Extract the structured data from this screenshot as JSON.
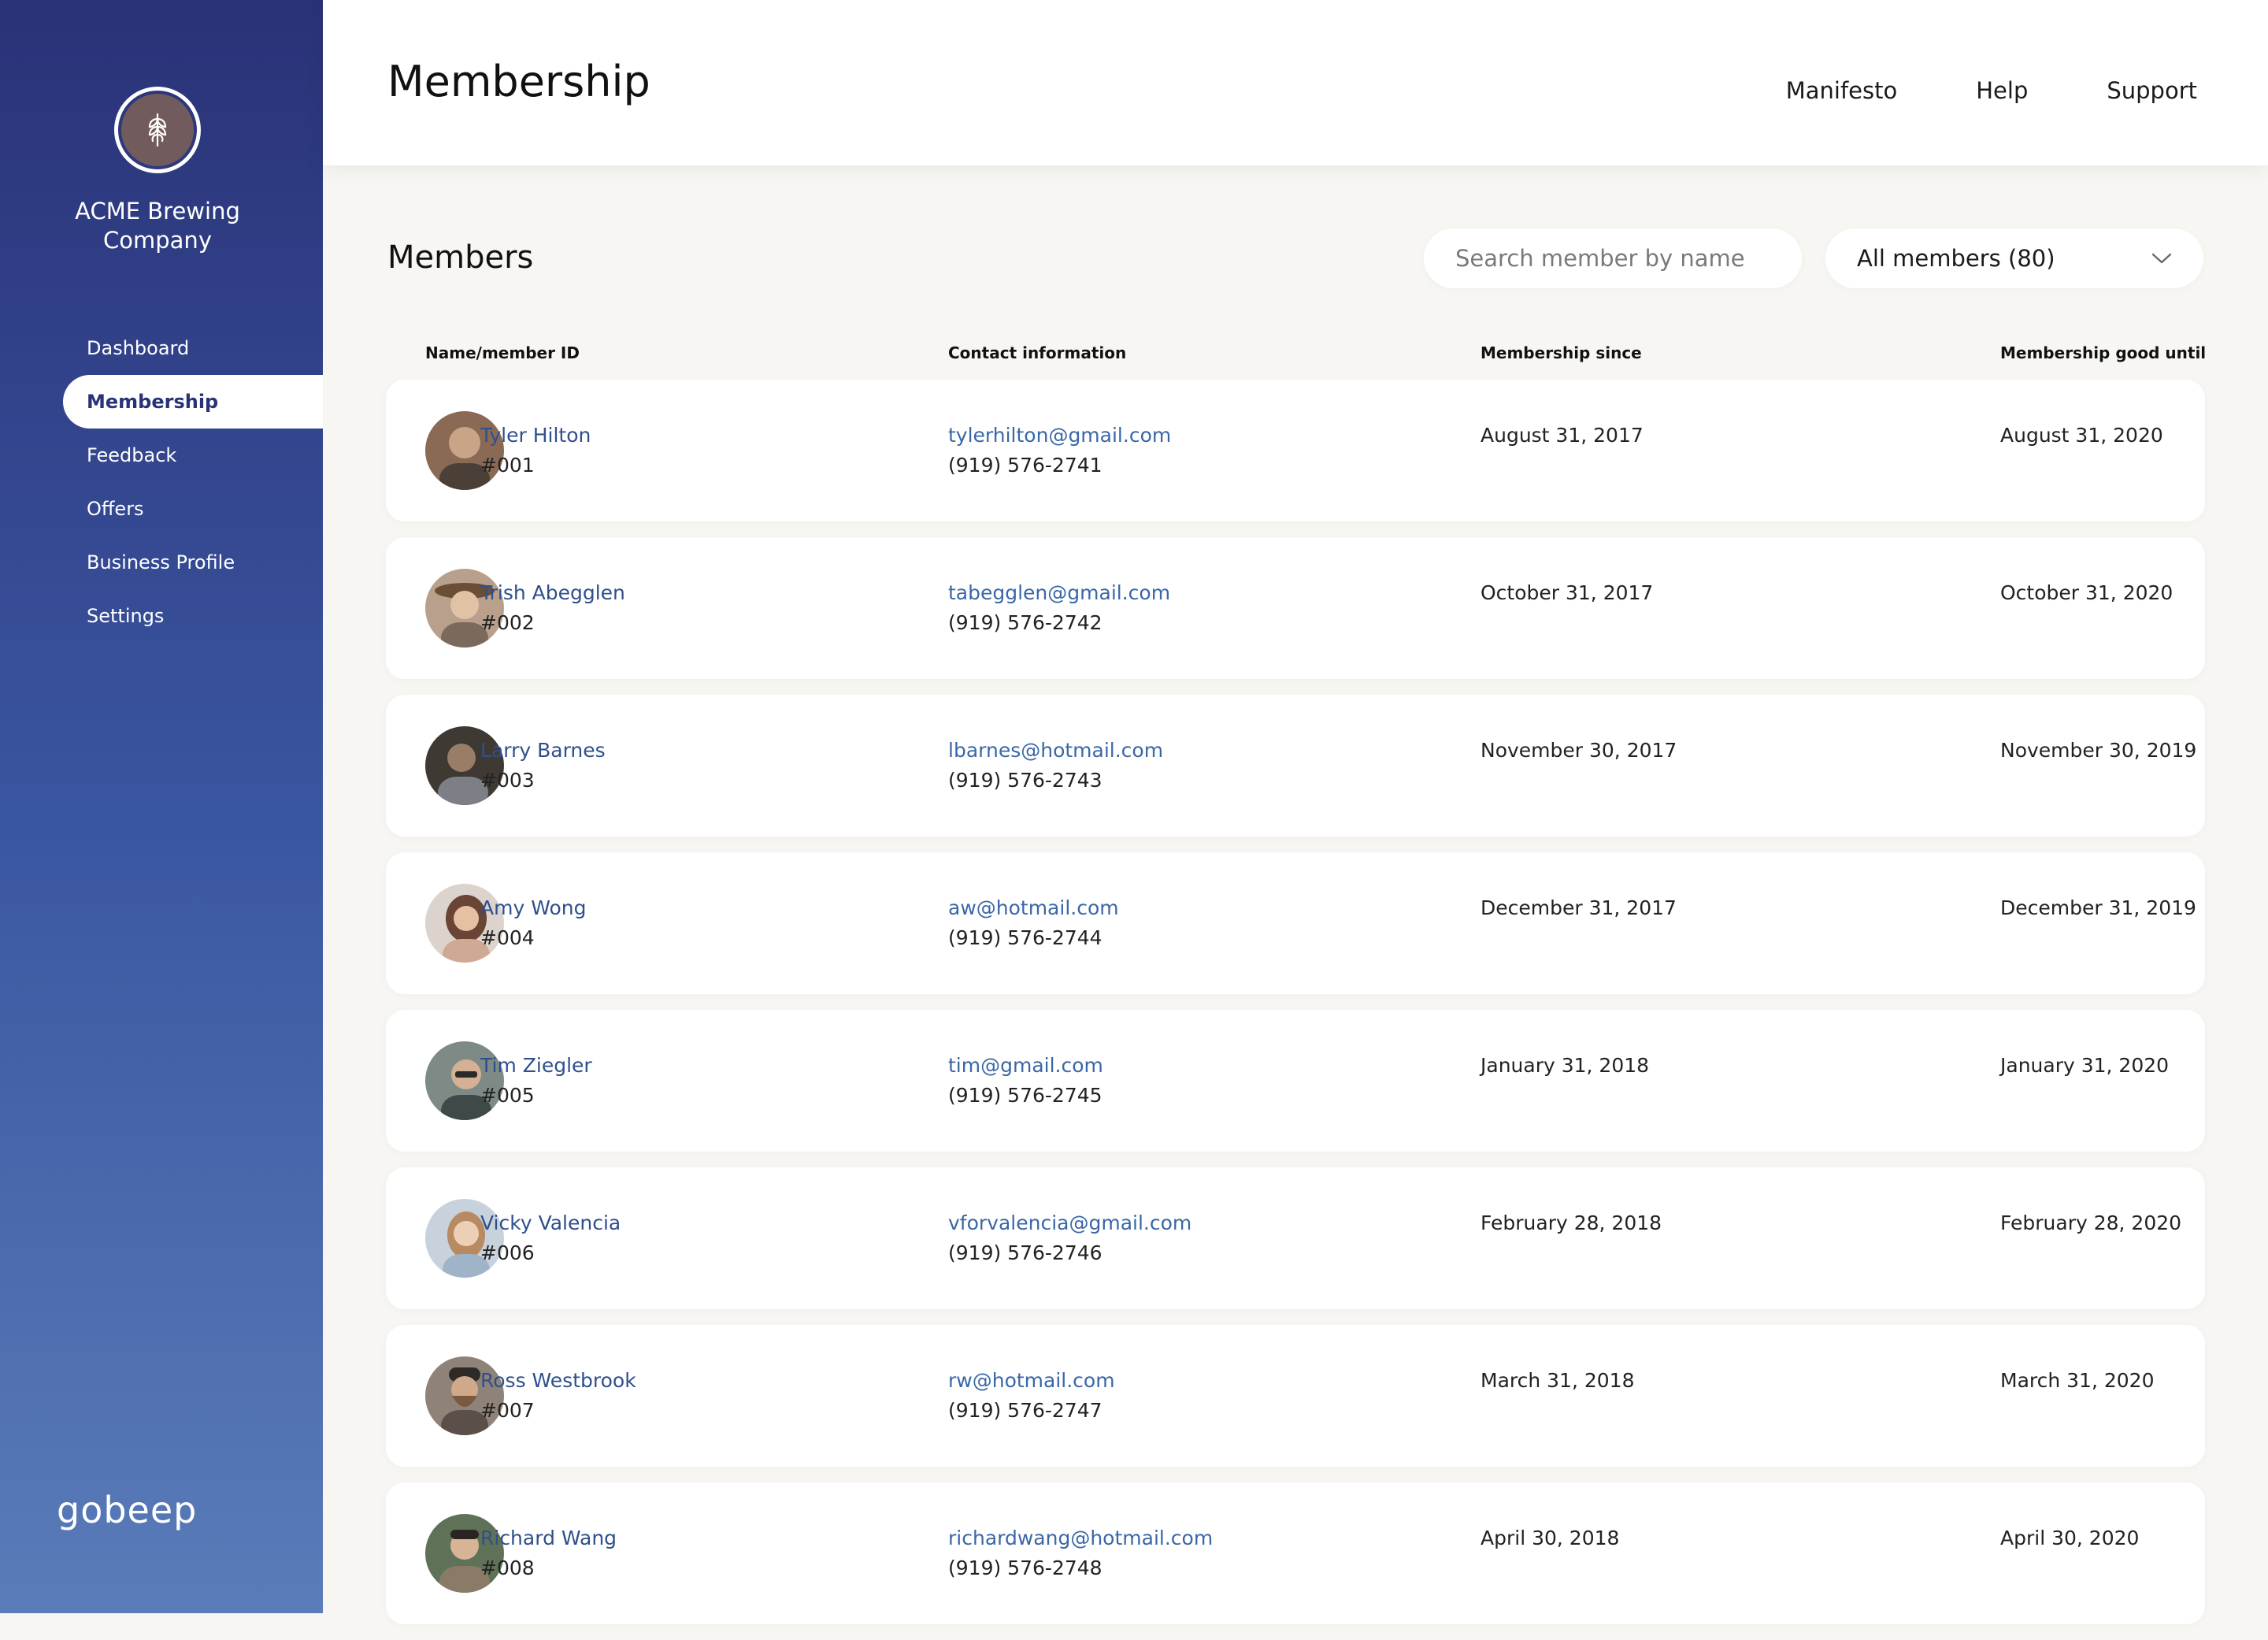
{
  "sidebar": {
    "company_name_line1": "ACME Brewing",
    "company_name_line2": "Company",
    "items": [
      {
        "label": "Dashboard"
      },
      {
        "label": "Membership"
      },
      {
        "label": "Feedback"
      },
      {
        "label": "Offers"
      },
      {
        "label": "Business Profile"
      },
      {
        "label": "Settings"
      }
    ],
    "active_index": 1,
    "footer_brand": "gobeep"
  },
  "header": {
    "title": "Membership",
    "nav": [
      {
        "label": "Manifesto"
      },
      {
        "label": "Help"
      },
      {
        "label": "Support"
      }
    ]
  },
  "members_section": {
    "title": "Members",
    "search_placeholder": "Search member by name",
    "filter_label": "All members (80)"
  },
  "table": {
    "columns": [
      "Name/member ID",
      "Contact information",
      "Membership since",
      "Membership good until"
    ],
    "rows": [
      {
        "name": "Tyler Hilton",
        "id": "#001",
        "email": "tylerhilton@gmail.com",
        "phone": "(919) 576-2741",
        "since": "August 31, 2017",
        "until": "August 31, 2020",
        "avatar_color": "#8a6a55"
      },
      {
        "name": "Trish Abegglen",
        "id": "#002",
        "email": "tabegglen@gmail.com",
        "phone": "(919) 576-2742",
        "since": "October 31, 2017",
        "until": "October 31, 2020",
        "avatar_color": "#9b7e6a"
      },
      {
        "name": "Larry Barnes",
        "id": "#003",
        "email": "lbarnes@hotmail.com",
        "phone": "(919) 576-2743",
        "since": "November 30, 2017",
        "until": "November 30, 2019",
        "avatar_color": "#4a4340"
      },
      {
        "name": "Amy Wong",
        "id": "#004",
        "email": "aw@hotmail.com",
        "phone": "(919) 576-2744",
        "since": "December 31, 2017",
        "until": "December 31, 2019",
        "avatar_color": "#c7a28a"
      },
      {
        "name": "Tim Ziegler",
        "id": "#005",
        "email": "tim@gmail.com",
        "phone": "(919) 576-2745",
        "since": "January 31, 2018",
        "until": "January 31, 2020",
        "avatar_color": "#5d6a66"
      },
      {
        "name": "Vicky Valencia",
        "id": "#006",
        "email": "vforvalencia@gmail.com",
        "phone": "(919) 576-2746",
        "since": "February 28, 2018",
        "until": "February 28, 2020",
        "avatar_color": "#a7b3c0"
      },
      {
        "name": "Ross Westbrook",
        "id": "#007",
        "email": "rw@hotmail.com",
        "phone": "(919) 576-2747",
        "since": "March 31, 2018",
        "until": "March 31, 2020",
        "avatar_color": "#6e6158"
      },
      {
        "name": "Richard Wang",
        "id": "#008",
        "email": "richardwang@hotmail.com",
        "phone": "(919) 576-2748",
        "since": "April 30, 2018",
        "until": "April 30, 2020",
        "avatar_color": "#5a6a52"
      }
    ]
  },
  "icons": {
    "logo": "hop-leaf-icon",
    "filter_chevron": "chevron-down-icon"
  },
  "colors": {
    "sidebar_top": "#2a3277",
    "sidebar_bottom": "#5a7cb8",
    "logo_fill": "#725b5c",
    "link": "#3a67a7"
  }
}
